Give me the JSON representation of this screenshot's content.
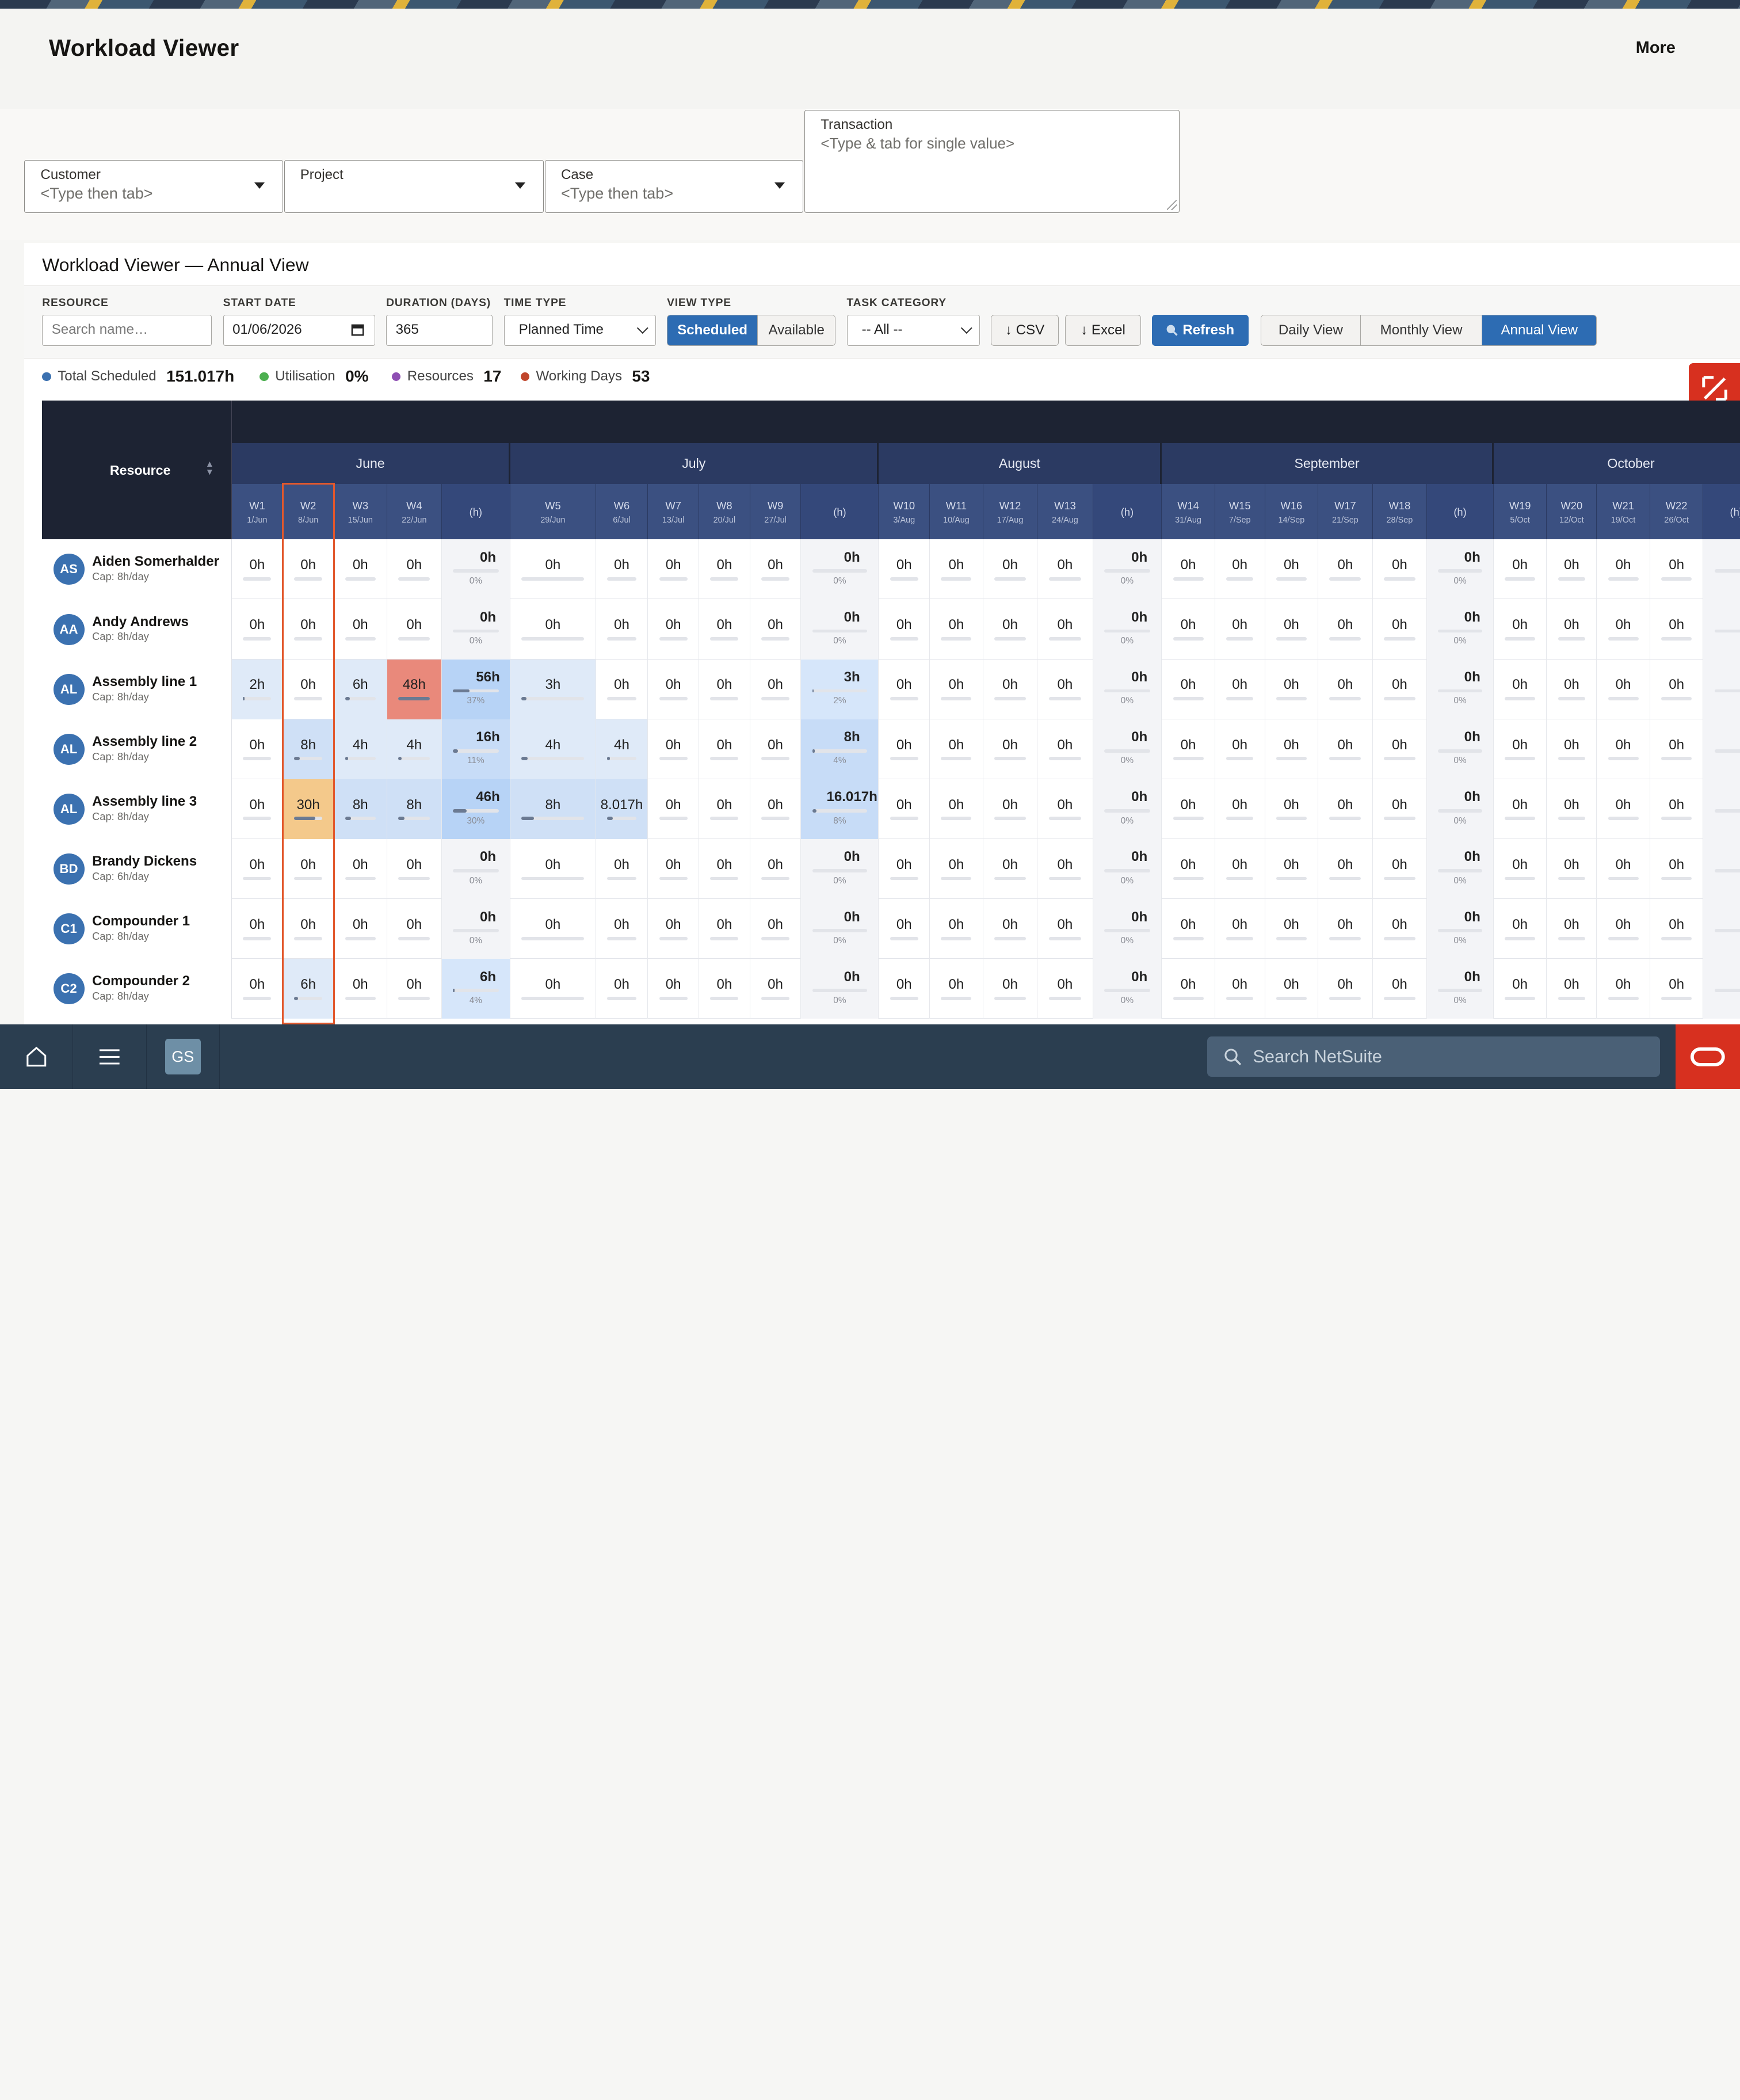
{
  "app": {
    "title": "Workload Viewer",
    "more": "More"
  },
  "filters": {
    "customer": {
      "label": "Customer",
      "placeholder": "<Type then tab>"
    },
    "project": {
      "label": "Project",
      "placeholder": ""
    },
    "case": {
      "label": "Case",
      "placeholder": "<Type then tab>"
    },
    "transaction": {
      "label": "Transaction",
      "placeholder": "<Type & tab for single value>"
    }
  },
  "panel": {
    "title": "Workload Viewer — Annual View",
    "labels": {
      "resource": "RESOURCE",
      "start_date": "START DATE",
      "duration": "DURATION (DAYS)",
      "time_type": "TIME TYPE",
      "view_type": "VIEW TYPE",
      "task_category": "TASK CATEGORY"
    },
    "resource_placeholder": "Search name…",
    "start_date": "01/06/2026",
    "duration": "365",
    "time_type": "Planned Time",
    "view_type_options": [
      "Scheduled",
      "Available"
    ],
    "view_type_selected": "Scheduled",
    "task_category": "-- All --",
    "csv": "↓ CSV",
    "excel": "↓ Excel",
    "refresh": "Refresh",
    "views": [
      "Daily View",
      "Monthly View",
      "Annual View"
    ],
    "view_selected": "Annual View"
  },
  "stats": [
    {
      "label": "Total Scheduled",
      "value": "151.017h",
      "color": "#3b71b0"
    },
    {
      "label": "Utilisation",
      "value": "0%",
      "color": "#4caf50"
    },
    {
      "label": "Resources",
      "value": "17",
      "color": "#8e4fb3"
    },
    {
      "label": "Working Days",
      "value": "53",
      "color": "#c0462c"
    }
  ],
  "grid": {
    "resource_header": "Resource",
    "months": [
      {
        "name": "June",
        "weeks": [
          [
            "W1",
            "1/Jun"
          ],
          [
            "W2",
            "8/Jun"
          ],
          [
            "W3",
            "15/Jun"
          ],
          [
            "W4",
            "22/Jun"
          ]
        ]
      },
      {
        "name": "July",
        "weeks": [
          [
            "W5",
            "29/Jun"
          ],
          [
            "W6",
            "6/Jul"
          ],
          [
            "W7",
            "13/Jul"
          ],
          [
            "W8",
            "20/Jul"
          ],
          [
            "W9",
            "27/Jul"
          ]
        ]
      },
      {
        "name": "August",
        "weeks": [
          [
            "W10",
            "3/Aug"
          ],
          [
            "W11",
            "10/Aug"
          ],
          [
            "W12",
            "17/Aug"
          ],
          [
            "W13",
            "24/Aug"
          ]
        ]
      },
      {
        "name": "September",
        "weeks": [
          [
            "W14",
            "31/Aug"
          ],
          [
            "W15",
            "7/Sep"
          ],
          [
            "W16",
            "14/Sep"
          ],
          [
            "W17",
            "21/Sep"
          ],
          [
            "W18",
            "28/Sep"
          ]
        ]
      },
      {
        "name": "October",
        "weeks": [
          [
            "W19",
            "5/Oct"
          ],
          [
            "W20",
            "12/Oct"
          ],
          [
            "W21",
            "19/Oct"
          ],
          [
            "W22",
            "26/Oct"
          ]
        ]
      }
    ],
    "sum_label": "(h)",
    "rows": [
      {
        "initials": "AS",
        "name": "Aiden Somerhalder",
        "cap": "Cap: 8h/day",
        "months": [
          {
            "w": [
              "0h",
              "0h",
              "0h",
              "0h"
            ],
            "t": "0h",
            "p": "0%"
          },
          {
            "w": [
              "0h",
              "0h",
              "0h",
              "0h",
              "0h"
            ],
            "t": "0h",
            "p": "0%"
          },
          {
            "w": [
              "0h",
              "0h",
              "0h",
              "0h"
            ],
            "t": "0h",
            "p": "0%"
          },
          {
            "w": [
              "0h",
              "0h",
              "0h",
              "0h",
              "0h"
            ],
            "t": "0h",
            "p": "0%"
          },
          {
            "w": [
              "0h",
              "0h",
              "0h",
              "0h"
            ],
            "t": "",
            "p": ""
          }
        ]
      },
      {
        "initials": "AA",
        "name": "Andy Andrews",
        "cap": "Cap: 8h/day",
        "months": [
          {
            "w": [
              "0h",
              "0h",
              "0h",
              "0h"
            ],
            "t": "0h",
            "p": "0%"
          },
          {
            "w": [
              "0h",
              "0h",
              "0h",
              "0h",
              "0h"
            ],
            "t": "0h",
            "p": "0%"
          },
          {
            "w": [
              "0h",
              "0h",
              "0h",
              "0h"
            ],
            "t": "0h",
            "p": "0%"
          },
          {
            "w": [
              "0h",
              "0h",
              "0h",
              "0h",
              "0h"
            ],
            "t": "0h",
            "p": "0%"
          },
          {
            "w": [
              "0h",
              "0h",
              "0h",
              "0h"
            ],
            "t": "",
            "p": ""
          }
        ]
      },
      {
        "initials": "AL",
        "name": "Assembly line 1",
        "cap": "Cap: 8h/day",
        "months": [
          {
            "w": [
              "2h",
              "0h",
              "6h",
              "48h"
            ],
            "t": "56h",
            "p": "37%"
          },
          {
            "w": [
              "3h",
              "0h",
              "0h",
              "0h",
              "0h"
            ],
            "t": "3h",
            "p": "2%"
          },
          {
            "w": [
              "0h",
              "0h",
              "0h",
              "0h"
            ],
            "t": "0h",
            "p": "0%"
          },
          {
            "w": [
              "0h",
              "0h",
              "0h",
              "0h",
              "0h"
            ],
            "t": "0h",
            "p": "0%"
          },
          {
            "w": [
              "0h",
              "0h",
              "0h",
              "0h"
            ],
            "t": "",
            "p": ""
          }
        ]
      },
      {
        "initials": "AL",
        "name": "Assembly line 2",
        "cap": "Cap: 8h/day",
        "months": [
          {
            "w": [
              "0h",
              "8h",
              "4h",
              "4h"
            ],
            "t": "16h",
            "p": "11%"
          },
          {
            "w": [
              "4h",
              "4h",
              "0h",
              "0h",
              "0h"
            ],
            "t": "8h",
            "p": "4%"
          },
          {
            "w": [
              "0h",
              "0h",
              "0h",
              "0h"
            ],
            "t": "0h",
            "p": "0%"
          },
          {
            "w": [
              "0h",
              "0h",
              "0h",
              "0h",
              "0h"
            ],
            "t": "0h",
            "p": "0%"
          },
          {
            "w": [
              "0h",
              "0h",
              "0h",
              "0h"
            ],
            "t": "",
            "p": ""
          }
        ]
      },
      {
        "initials": "AL",
        "name": "Assembly line 3",
        "cap": "Cap: 8h/day",
        "months": [
          {
            "w": [
              "0h",
              "30h",
              "8h",
              "8h"
            ],
            "t": "46h",
            "p": "30%"
          },
          {
            "w": [
              "8h",
              "8.017h",
              "0h",
              "0h",
              "0h"
            ],
            "t": "16.017h",
            "p": "8%"
          },
          {
            "w": [
              "0h",
              "0h",
              "0h",
              "0h"
            ],
            "t": "0h",
            "p": "0%"
          },
          {
            "w": [
              "0h",
              "0h",
              "0h",
              "0h",
              "0h"
            ],
            "t": "0h",
            "p": "0%"
          },
          {
            "w": [
              "0h",
              "0h",
              "0h",
              "0h"
            ],
            "t": "",
            "p": ""
          }
        ]
      },
      {
        "initials": "BD",
        "name": "Brandy Dickens",
        "cap": "Cap: 6h/day",
        "months": [
          {
            "w": [
              "0h",
              "0h",
              "0h",
              "0h"
            ],
            "t": "0h",
            "p": "0%"
          },
          {
            "w": [
              "0h",
              "0h",
              "0h",
              "0h",
              "0h"
            ],
            "t": "0h",
            "p": "0%"
          },
          {
            "w": [
              "0h",
              "0h",
              "0h",
              "0h"
            ],
            "t": "0h",
            "p": "0%"
          },
          {
            "w": [
              "0h",
              "0h",
              "0h",
              "0h",
              "0h"
            ],
            "t": "0h",
            "p": "0%"
          },
          {
            "w": [
              "0h",
              "0h",
              "0h",
              "0h"
            ],
            "t": "",
            "p": ""
          }
        ]
      },
      {
        "initials": "C1",
        "name": "Compounder 1",
        "cap": "Cap: 8h/day",
        "months": [
          {
            "w": [
              "0h",
              "0h",
              "0h",
              "0h"
            ],
            "t": "0h",
            "p": "0%"
          },
          {
            "w": [
              "0h",
              "0h",
              "0h",
              "0h",
              "0h"
            ],
            "t": "0h",
            "p": "0%"
          },
          {
            "w": [
              "0h",
              "0h",
              "0h",
              "0h"
            ],
            "t": "0h",
            "p": "0%"
          },
          {
            "w": [
              "0h",
              "0h",
              "0h",
              "0h",
              "0h"
            ],
            "t": "0h",
            "p": "0%"
          },
          {
            "w": [
              "0h",
              "0h",
              "0h",
              "0h"
            ],
            "t": "",
            "p": ""
          }
        ]
      },
      {
        "initials": "C2",
        "name": "Compounder 2",
        "cap": "Cap: 8h/day",
        "months": [
          {
            "w": [
              "0h",
              "6h",
              "0h",
              "0h"
            ],
            "t": "6h",
            "p": "4%"
          },
          {
            "w": [
              "0h",
              "0h",
              "0h",
              "0h",
              "0h"
            ],
            "t": "0h",
            "p": "0%"
          },
          {
            "w": [
              "0h",
              "0h",
              "0h",
              "0h"
            ],
            "t": "0h",
            "p": "0%"
          },
          {
            "w": [
              "0h",
              "0h",
              "0h",
              "0h",
              "0h"
            ],
            "t": "0h",
            "p": "0%"
          },
          {
            "w": [
              "0h",
              "0h",
              "0h",
              "0h"
            ],
            "t": "",
            "p": ""
          }
        ]
      }
    ]
  },
  "footer": {
    "avatar": "GS",
    "search_placeholder": "Search NetSuite"
  },
  "colors": {
    "accent": "#2d6cb3",
    "header_dark": "#1d2333",
    "month_bar": "#2b3a62",
    "week_bar": "#3b5081",
    "overload": "#e9897b",
    "warning": "#f4c98b",
    "highlight": "#e2582c",
    "footer": "#2b3e50",
    "brand_red": "#d7301f"
  }
}
